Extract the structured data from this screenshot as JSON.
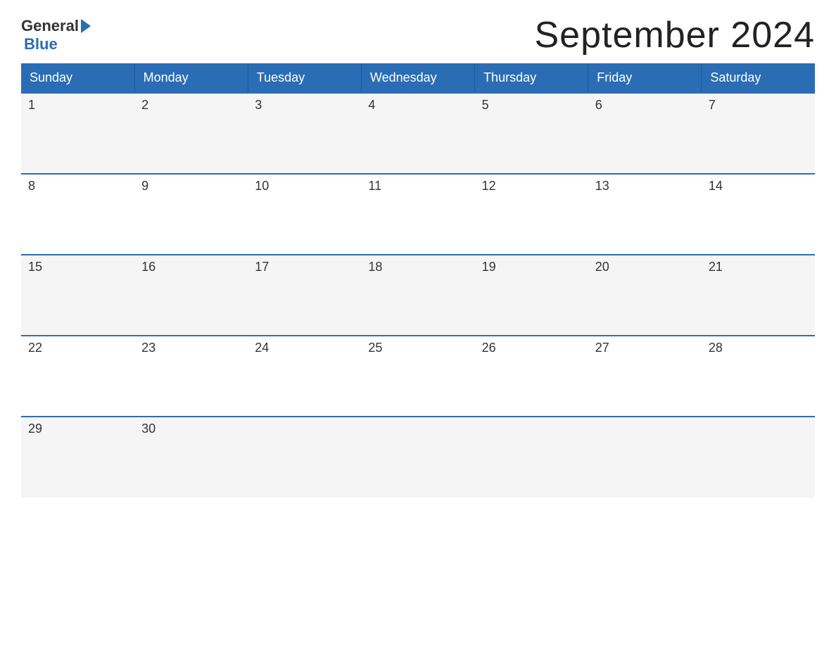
{
  "logo": {
    "general_text": "General",
    "blue_text": "Blue"
  },
  "title": "September 2024",
  "days_of_week": [
    "Sunday",
    "Monday",
    "Tuesday",
    "Wednesday",
    "Thursday",
    "Friday",
    "Saturday"
  ],
  "weeks": [
    [
      {
        "day": "1",
        "empty": false
      },
      {
        "day": "2",
        "empty": false
      },
      {
        "day": "3",
        "empty": false
      },
      {
        "day": "4",
        "empty": false
      },
      {
        "day": "5",
        "empty": false
      },
      {
        "day": "6",
        "empty": false
      },
      {
        "day": "7",
        "empty": false
      }
    ],
    [
      {
        "day": "8",
        "empty": false
      },
      {
        "day": "9",
        "empty": false
      },
      {
        "day": "10",
        "empty": false
      },
      {
        "day": "11",
        "empty": false
      },
      {
        "day": "12",
        "empty": false
      },
      {
        "day": "13",
        "empty": false
      },
      {
        "day": "14",
        "empty": false
      }
    ],
    [
      {
        "day": "15",
        "empty": false
      },
      {
        "day": "16",
        "empty": false
      },
      {
        "day": "17",
        "empty": false
      },
      {
        "day": "18",
        "empty": false
      },
      {
        "day": "19",
        "empty": false
      },
      {
        "day": "20",
        "empty": false
      },
      {
        "day": "21",
        "empty": false
      }
    ],
    [
      {
        "day": "22",
        "empty": false
      },
      {
        "day": "23",
        "empty": false
      },
      {
        "day": "24",
        "empty": false
      },
      {
        "day": "25",
        "empty": false
      },
      {
        "day": "26",
        "empty": false
      },
      {
        "day": "27",
        "empty": false
      },
      {
        "day": "28",
        "empty": false
      }
    ],
    [
      {
        "day": "29",
        "empty": false
      },
      {
        "day": "30",
        "empty": false
      },
      {
        "day": "",
        "empty": true
      },
      {
        "day": "",
        "empty": true
      },
      {
        "day": "",
        "empty": true
      },
      {
        "day": "",
        "empty": true
      },
      {
        "day": "",
        "empty": true
      }
    ]
  ],
  "colors": {
    "header_bg": "#2a6db5",
    "header_text": "#ffffff",
    "odd_row_bg": "#f5f5f5",
    "even_row_bg": "#ffffff",
    "border_color": "#2a6db5",
    "text_color": "#333333"
  }
}
